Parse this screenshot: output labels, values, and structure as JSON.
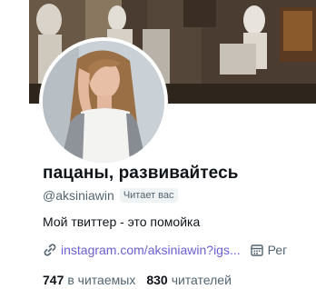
{
  "profile": {
    "display_name": "пацаны, развивайтесь",
    "handle": "@aksiniawin",
    "follows_you": "Читает вас",
    "bio": "Мой твиттер - это помойка",
    "website": "instagram.com/aksiniawin?igs...",
    "joined": "Рег",
    "following_count": "747",
    "following_label": "в читаемых",
    "followers_count": "830",
    "followers_label": "читателей"
  },
  "icons": {
    "link": "link-icon",
    "calendar": "calendar-icon"
  },
  "colors": {
    "link": "#6b5fd0",
    "secondary_text": "#536471",
    "primary_text": "#0f1419"
  }
}
